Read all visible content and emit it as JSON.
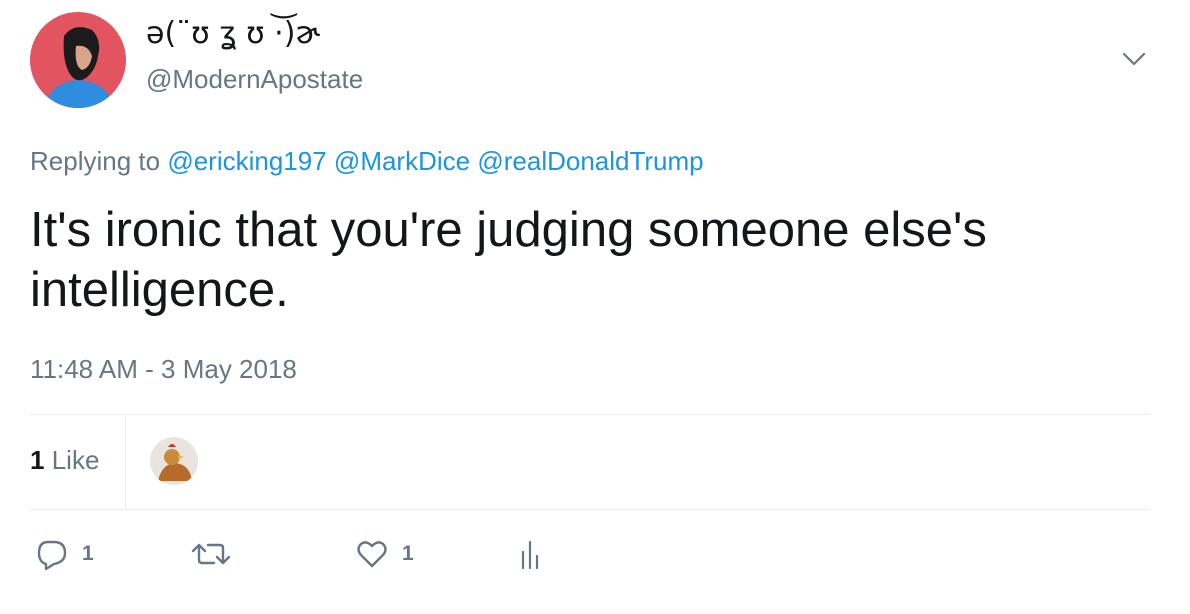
{
  "profile": {
    "display_name": "ə(¨ʊ ʓ ʊ ·͝)ɚ",
    "handle": "@ModernApostate"
  },
  "icons": {
    "menu": "chevron-down-icon",
    "reply": "reply-icon",
    "retweet": "retweet-icon",
    "like": "heart-icon",
    "analytics": "analytics-icon"
  },
  "tweet": {
    "replying_prefix": "Replying to",
    "mentions": [
      "@ericking197",
      "@MarkDice",
      "@realDonaldTrump"
    ],
    "text": "It's ironic that you're judging someone else's intelligence.",
    "timestamp": "11:48 AM - 3 May 2018"
  },
  "stats": {
    "likes_count": "1",
    "likes_label": "Like"
  },
  "actions": {
    "reply_count": "1",
    "like_count": "1"
  },
  "colors": {
    "link": "#1b95e0",
    "muted": "#657786",
    "text": "#14171a",
    "avatar_bg": "#e2545f",
    "avatar_shirt": "#2f8de0"
  }
}
